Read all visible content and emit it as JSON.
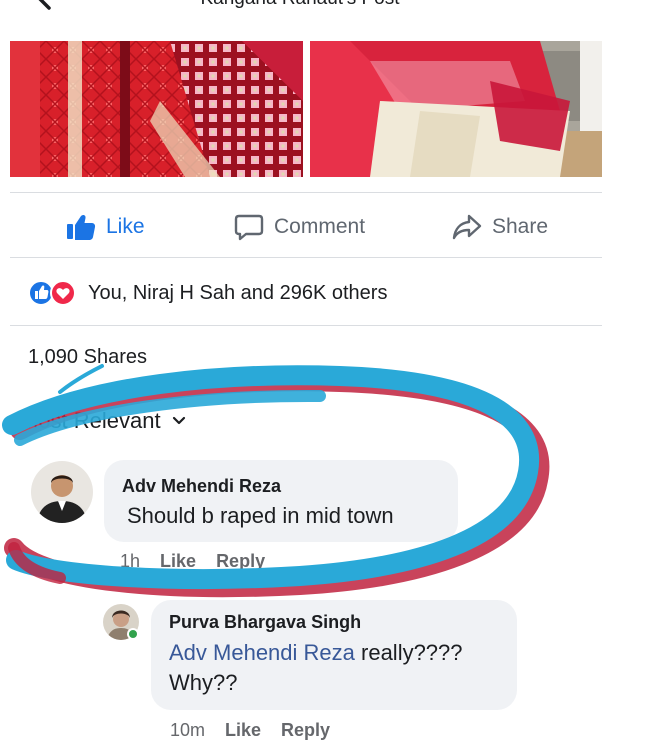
{
  "header": {
    "title": "Kangana Ranaut's Post"
  },
  "actions": {
    "like": "Like",
    "comment": "Comment",
    "share": "Share"
  },
  "reactions": {
    "summary": "You, Niraj H Sah and 296K others"
  },
  "shares": {
    "label": "1,090 Shares"
  },
  "sort": {
    "label": "Most Relevant"
  },
  "comments": [
    {
      "author": "Adv Mehendi Reza",
      "text": "Should b raped in mid town",
      "time": "1h",
      "like": "Like",
      "reply": "Reply"
    },
    {
      "author": "Purva Bhargava Singh",
      "mention": "Adv Mehendi Reza",
      "text_line1": " really????",
      "text_line2": "Why??",
      "time": "10m",
      "like": "Like",
      "reply": "Reply"
    }
  ],
  "colors": {
    "accent": "#1b74e4",
    "highlight_stroke": "#2aa9d8",
    "highlight_stroke_shadow": "#c0223e"
  }
}
